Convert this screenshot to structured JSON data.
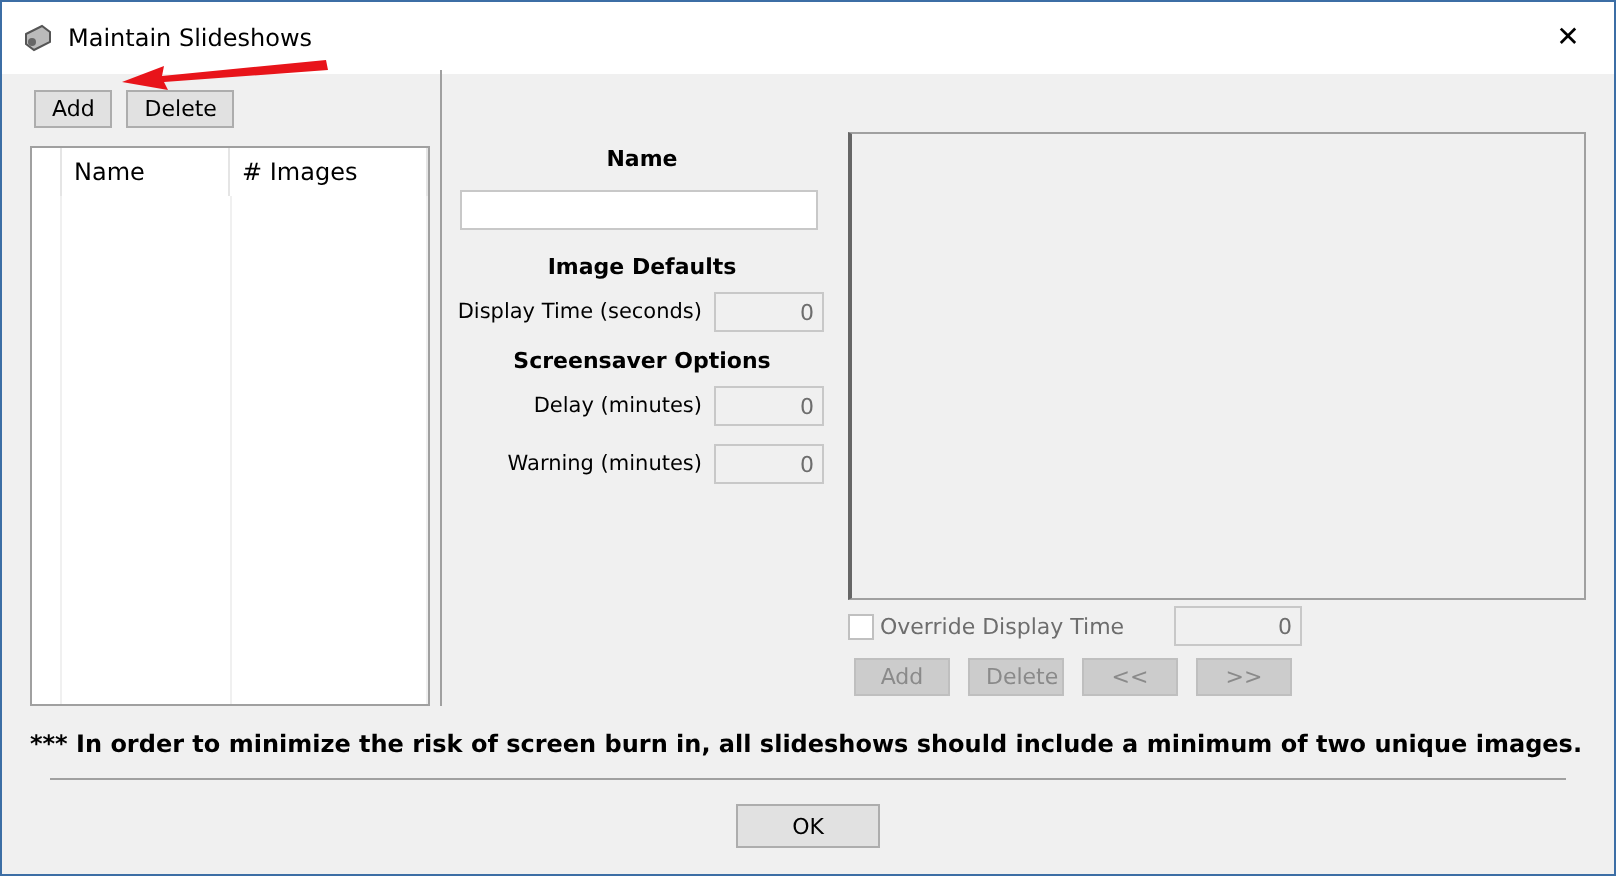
{
  "window": {
    "title": "Maintain Slideshows",
    "close": "✕"
  },
  "list_buttons": [
    {
      "label": "Add",
      "disabled": false
    },
    {
      "label": "Delete",
      "disabled": false
    }
  ],
  "slideshow_table": {
    "columns": [
      "Name",
      "# Images"
    ]
  },
  "form": {
    "name_heading": "Name",
    "image_defaults_heading": "Image Defaults",
    "display_time": {
      "label": "Display Time (seconds)",
      "value": "0",
      "disabled": true
    },
    "screensaver_heading": "Screensaver Options",
    "delay": {
      "label": "Delay (minutes)",
      "value": "0",
      "disabled": true
    },
    "warning": {
      "label": "Warning (minutes)",
      "value": "0",
      "disabled": true
    }
  },
  "override": {
    "label": "Override Display Time",
    "checked": false,
    "value": "0",
    "disabled": true
  },
  "image_buttons": [
    {
      "label": "Add",
      "disabled": true
    },
    {
      "label": "Delete",
      "disabled": true
    },
    {
      "label": "<<",
      "disabled": true
    },
    {
      "label": ">>",
      "disabled": true
    }
  ],
  "note": "*** In order to minimize the risk of screen burn in, all slideshows should include a minimum of two unique images.",
  "ok_button": {
    "label": "OK",
    "disabled": false
  }
}
